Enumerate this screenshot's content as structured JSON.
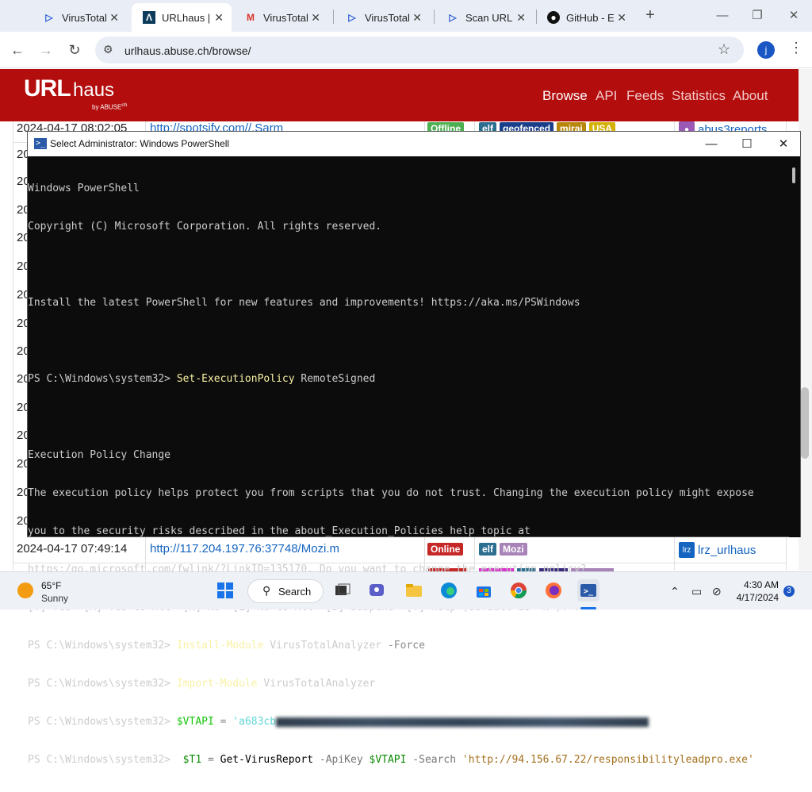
{
  "browser": {
    "tabs": [
      {
        "title": "VirusTotal",
        "icon": "virustotal-icon",
        "active": false
      },
      {
        "title": "URLhaus | ",
        "icon": "urlhaus-icon",
        "active": true
      },
      {
        "title": "VirusTotal",
        "icon": "gmail-icon",
        "active": false
      },
      {
        "title": "VirusTotal",
        "icon": "virustotal-icon",
        "active": false
      },
      {
        "title": "Scan URL",
        "icon": "virustotal-icon",
        "active": false
      },
      {
        "title": "GitHub - E",
        "icon": "github-icon",
        "active": false
      }
    ],
    "url": "urlhaus.abuse.ch/browse/",
    "profile_initial": "j"
  },
  "site": {
    "logo": "URL",
    "logo_suffix": "haus",
    "logo_by": "by ABUSE",
    "logo_ch": "ch",
    "nav": [
      "Browse",
      "API",
      "Feeds",
      "Statistics",
      "About"
    ],
    "rows": [
      {
        "date": "2024-04-17 08:02:05",
        "url": "http://spotsify.com//.Sarm",
        "status": "Offline",
        "tags": [
          "elf",
          "geofenced",
          "mirai",
          "USA"
        ],
        "reporter": "abus3reports"
      },
      {
        "date": "2024-04-17 07:49:14",
        "url": "http://117.204.197.76:37748/Mozi.m",
        "status": "Online",
        "tags": [
          "elf",
          "Mozi"
        ],
        "reporter": "lrz_urlhaus"
      }
    ],
    "partial_rows": [
      "20",
      "20",
      "20",
      "20",
      "20",
      "20",
      "20",
      "20",
      "20",
      "20",
      "20",
      "20",
      "20",
      "20",
      "20"
    ]
  },
  "powershell": {
    "title": "Select Administrator: Windows PowerShell",
    "line1": "Windows PowerShell",
    "line2": "Copyright (C) Microsoft Corporation. All rights reserved.",
    "line3": "Install the latest PowerShell for new features and improvements! https://aka.ms/PSWindows",
    "prompt": "PS C:\\Windows\\system32> ",
    "cmd1": "Set-ExecutionPolicy",
    "cmd1_arg": " RemoteSigned",
    "policy_header": "Execution Policy Change",
    "policy1": "The execution policy helps protect you from scripts that you do not trust. Changing the execution policy might expose",
    "policy2": "you to the security risks described in the about_Execution_Policies help topic at",
    "policy3": "https:/go.microsoft.com/fwlink/?LinkID=135170. Do you want to change the execution policy?",
    "policy_options": "[Y] Yes  [A] Yes to All  [N] No  [L] No to All  [S] Suspend  [?] Help (default is \"N\"): Y",
    "cmd2": "Install-Module",
    "cmd2_arg": " VirusTotalAnalyzer ",
    "cmd2_param": "-Force",
    "cmd3": "Import-Module",
    "cmd3_arg": " VirusTotalAnalyzer",
    "cmd4_var": "$VTAPI",
    "cmd4_op": " = ",
    "cmd4_str": "'a683cb",
    "cmd5_var": " $T1",
    "cmd5_op": " = ",
    "cmd5_cmd": "Get-VirusReport",
    "cmd5_p1": " -ApiKey ",
    "cmd5_v1": "$VTAPI",
    "cmd5_p2": " -Search ",
    "cmd5_str": "'http://94.156.67.22/responsibilityleadpro.exe'"
  },
  "taskbar": {
    "temperature": "65°F",
    "condition": "Sunny",
    "search_label": "Search",
    "time": "4:30 AM",
    "date": "4/17/2024",
    "notifications": "3"
  }
}
